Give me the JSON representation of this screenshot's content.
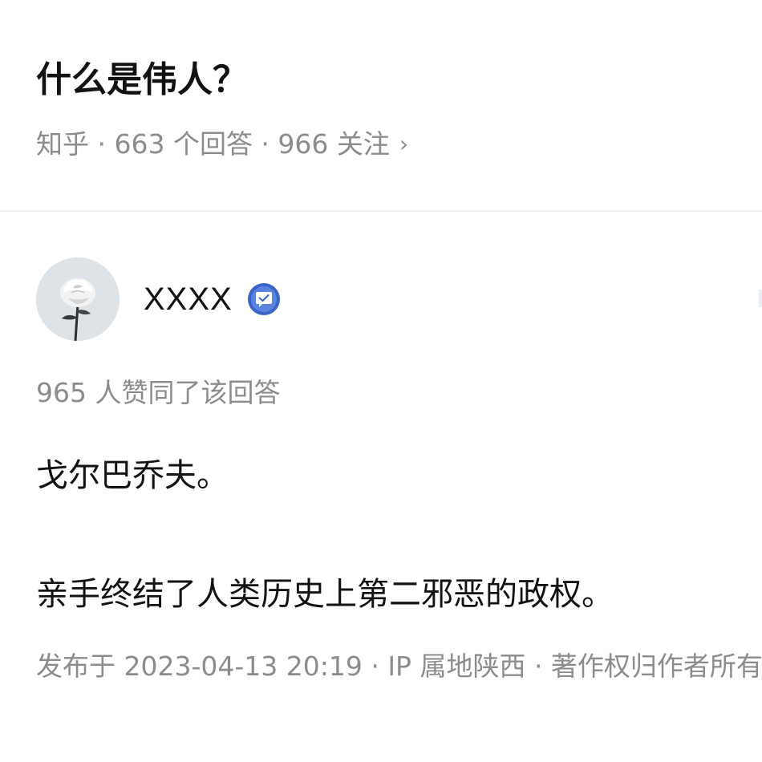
{
  "question": {
    "title": "什么是伟人？",
    "meta": "知乎 · 663 个回答 · 966 关注",
    "chevron": "›"
  },
  "answer": {
    "author": {
      "name": "XXXX",
      "avatar_icon": "white-rose-avatar",
      "badge_icon": "verified-badge-icon"
    },
    "upvote_text": "965 人赞同了该回答",
    "paragraphs": [
      "戈尔巴乔夫。",
      "亲手终结了人类历史上第二邪恶的政权。"
    ],
    "publish_info": "发布于 2023-04-13 20:19 · IP 属地陕西 · 著作权归作者所有"
  },
  "colors": {
    "title": "#121212",
    "meta_gray": "#8c8c8c",
    "badge_blue": "#3a64c8",
    "divider": "#ececec"
  }
}
